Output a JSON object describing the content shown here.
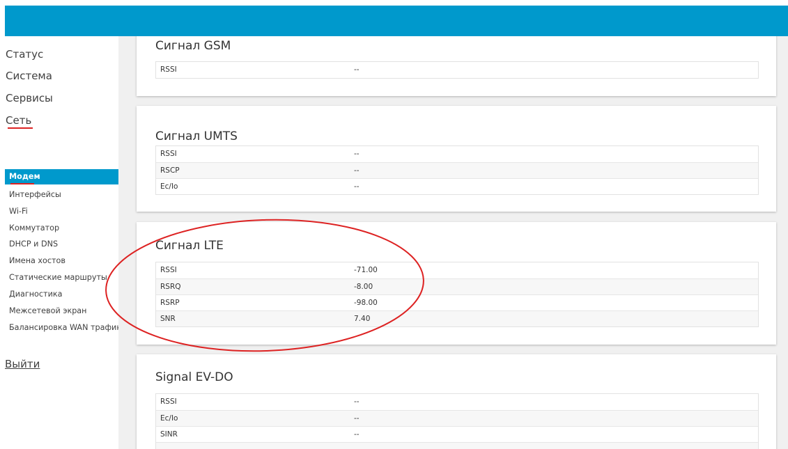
{
  "sidebar": {
    "top_items": [
      {
        "label": "Статус"
      },
      {
        "label": "Система"
      },
      {
        "label": "Сервисы"
      },
      {
        "label": "Сеть"
      }
    ],
    "sub_items": [
      {
        "label": "Модем"
      },
      {
        "label": "Интерфейсы"
      },
      {
        "label": "Wi-Fi"
      },
      {
        "label": "Коммутатор"
      },
      {
        "label": "DHCP и DNS"
      },
      {
        "label": "Имена хостов"
      },
      {
        "label": "Статические маршруты"
      },
      {
        "label": "Диагностика"
      },
      {
        "label": "Межсетевой экран"
      },
      {
        "label": "Балансировка WAN трафик"
      }
    ],
    "logout": "Выйти"
  },
  "cards": [
    {
      "title": "Сигнал GSM",
      "rows": [
        [
          "RSSI",
          "--"
        ]
      ]
    },
    {
      "title": "Сигнал UMTS",
      "rows": [
        [
          "RSSI",
          "--"
        ],
        [
          "RSCP",
          "--"
        ],
        [
          "Ec/Io",
          "--"
        ]
      ]
    },
    {
      "title": "Сигнал LTE",
      "rows": [
        [
          "RSSI",
          "-71.00"
        ],
        [
          "RSRQ",
          "-8.00"
        ],
        [
          "RSRP",
          "-98.00"
        ],
        [
          "SNR",
          "7.40"
        ]
      ]
    },
    {
      "title": "Signal EV-DO",
      "rows": [
        [
          "RSSI",
          "--"
        ],
        [
          "Ec/Io",
          "--"
        ],
        [
          "SINR",
          "--"
        ]
      ]
    }
  ],
  "colors": {
    "accent": "#0099cc",
    "annotation": "#dd2222"
  }
}
